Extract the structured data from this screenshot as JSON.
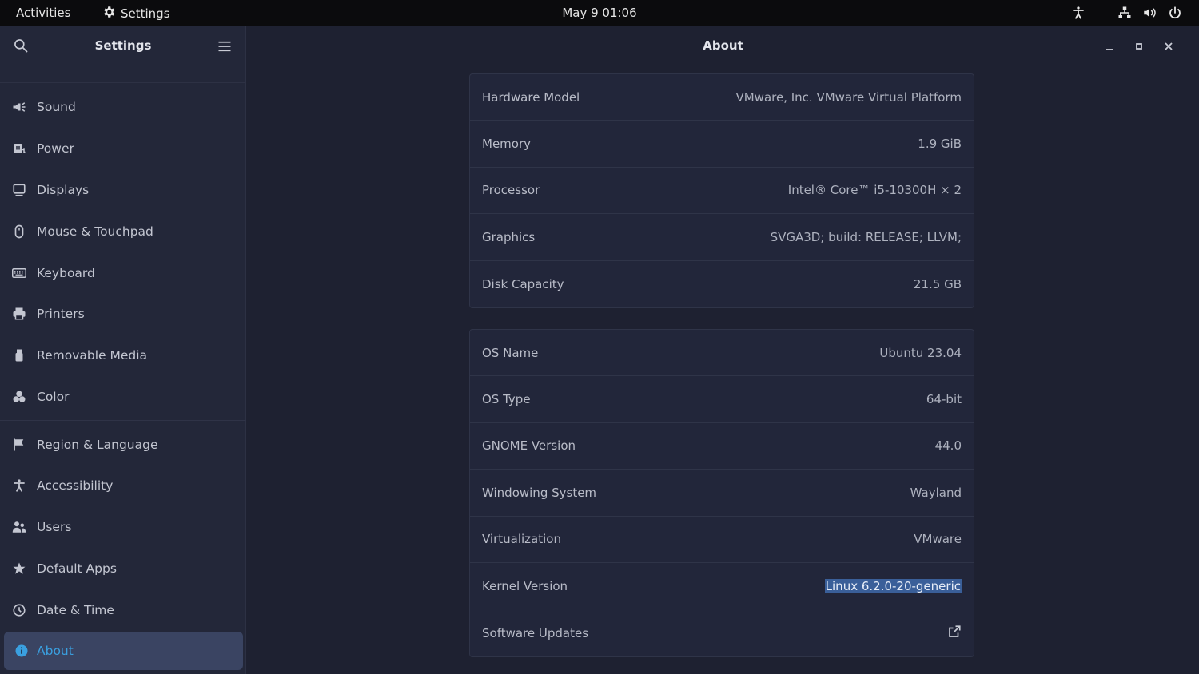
{
  "topbar": {
    "activities": "Activities",
    "app_name": "Settings",
    "clock": "May 9  01:06"
  },
  "sidebar": {
    "title": "Settings",
    "items": [
      {
        "label": "Sound",
        "icon": "speaker-icon"
      },
      {
        "label": "Power",
        "icon": "power-plug-icon"
      },
      {
        "label": "Displays",
        "icon": "display-icon"
      },
      {
        "label": "Mouse & Touchpad",
        "icon": "mouse-icon"
      },
      {
        "label": "Keyboard",
        "icon": "keyboard-icon"
      },
      {
        "label": "Printers",
        "icon": "printer-icon"
      },
      {
        "label": "Removable Media",
        "icon": "usb-icon"
      },
      {
        "label": "Color",
        "icon": "color-icon"
      },
      {
        "label": "Region & Language",
        "icon": "flag-icon"
      },
      {
        "label": "Accessibility",
        "icon": "accessibility-icon"
      },
      {
        "label": "Users",
        "icon": "users-icon"
      },
      {
        "label": "Default Apps",
        "icon": "star-icon"
      },
      {
        "label": "Date & Time",
        "icon": "clock-icon"
      },
      {
        "label": "About",
        "icon": "info-icon",
        "active": true
      }
    ]
  },
  "main": {
    "title": "About",
    "hardware": [
      {
        "key": "Hardware Model",
        "value": "VMware, Inc. VMware Virtual Platform"
      },
      {
        "key": "Memory",
        "value": "1.9 GiB"
      },
      {
        "key": "Processor",
        "value": "Intel® Core™ i5-10300H × 2"
      },
      {
        "key": "Graphics",
        "value": "SVGA3D; build: RELEASE; LLVM;"
      },
      {
        "key": "Disk Capacity",
        "value": "21.5 GB"
      }
    ],
    "software": [
      {
        "key": "OS Name",
        "value": "Ubuntu 23.04"
      },
      {
        "key": "OS Type",
        "value": "64-bit"
      },
      {
        "key": "GNOME Version",
        "value": "44.0"
      },
      {
        "key": "Windowing System",
        "value": "Wayland"
      },
      {
        "key": "Virtualization",
        "value": "VMware"
      },
      {
        "key": "Kernel Version",
        "value": "Linux 6.2.0-20-generic"
      },
      {
        "key": "Software Updates",
        "value": ""
      }
    ]
  },
  "colors": {
    "accent": "#3aa0e0",
    "selection": "#3a5f99",
    "background": "#1e2131",
    "sidebar": "#232739"
  }
}
